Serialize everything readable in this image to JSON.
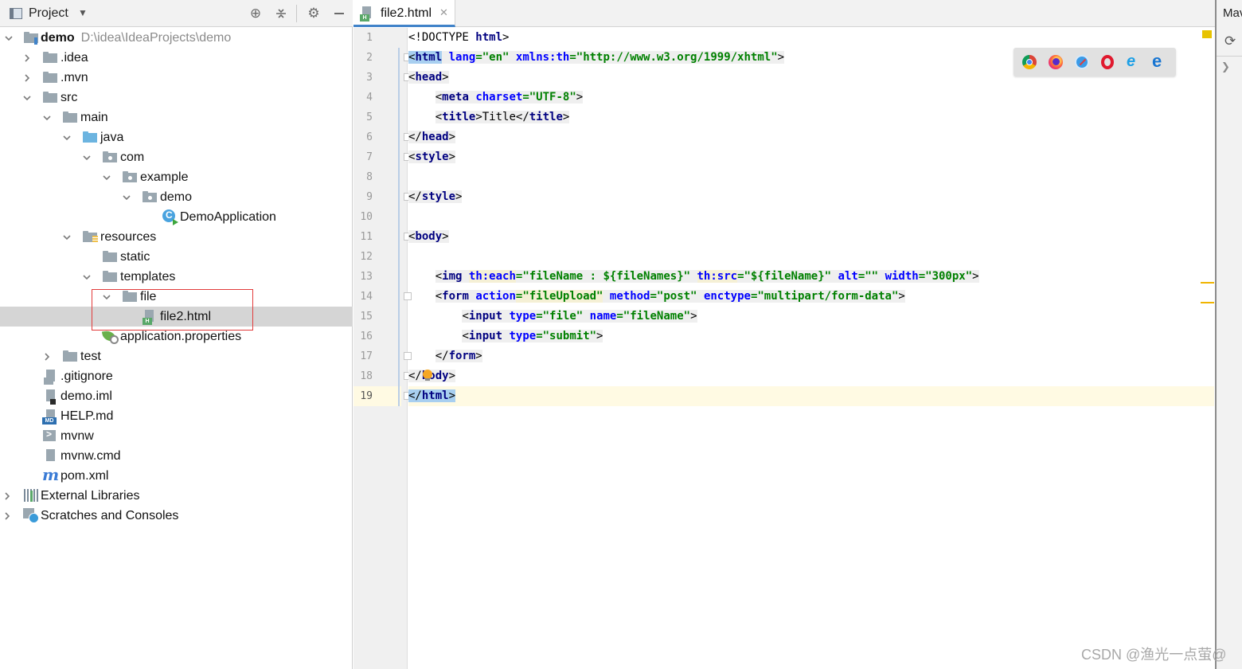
{
  "project_panel": {
    "view_label": "Project",
    "tree": [
      {
        "label": "demo",
        "path": "D:\\idea\\IdeaProjects\\demo"
      },
      {
        "label": ".idea"
      },
      {
        "label": ".mvn"
      },
      {
        "label": "src"
      },
      {
        "label": "main"
      },
      {
        "label": "java"
      },
      {
        "label": "com"
      },
      {
        "label": "example"
      },
      {
        "label": "demo"
      },
      {
        "label": "DemoApplication"
      },
      {
        "label": "resources"
      },
      {
        "label": "static"
      },
      {
        "label": "templates"
      },
      {
        "label": "file"
      },
      {
        "label": "file2.html"
      },
      {
        "label": "application.properties"
      },
      {
        "label": "test"
      },
      {
        "label": ".gitignore"
      },
      {
        "label": "demo.iml"
      },
      {
        "label": "HELP.md"
      },
      {
        "label": "mvnw"
      },
      {
        "label": "mvnw.cmd"
      },
      {
        "label": "pom.xml"
      },
      {
        "label": "External Libraries"
      },
      {
        "label": "Scratches and Consoles"
      }
    ]
  },
  "editor": {
    "tab_label": "file2.html",
    "line_numbers": [
      "1",
      "2",
      "3",
      "4",
      "5",
      "6",
      "7",
      "8",
      "9",
      "10",
      "11",
      "12",
      "13",
      "14",
      "15",
      "16",
      "17",
      "18",
      "19"
    ],
    "current_line": "19",
    "code_lines": [
      "<!DOCTYPE html>",
      "<html lang=\"en\" xmlns:th=\"http://www.w3.org/1999/xhtml\">",
      "<head>",
      "    <meta charset=\"UTF-8\">",
      "    <title>Title</title>",
      "</head>",
      "<style>",
      "",
      "</style>",
      "",
      "<body>",
      "",
      "    <img th:each=\"fileName : ${fileNames}\" th:src=\"${fileName}\" alt=\"\" width=\"300px\">",
      "    <form action=\"fileUpload\" method=\"post\" enctype=\"multipart/form-data\">",
      "        <input type=\"file\" name=\"fileName\">",
      "        <input type=\"submit\">",
      "    </form>",
      "</body>",
      "</html>"
    ],
    "browser_icons": [
      "chrome-icon",
      "firefox-icon",
      "safari-icon",
      "opera-icon",
      "internet-explorer-icon",
      "edge-icon"
    ]
  },
  "maven_panel": {
    "label": "Mav"
  },
  "watermark": "CSDN @渔光一点萤@",
  "colors": {
    "tag": "#000080",
    "attr": "#0000ff",
    "value": "#008000",
    "selection": "#a8cff0",
    "current_line": "#fffae3",
    "highlight_box": "#e23b3b"
  }
}
